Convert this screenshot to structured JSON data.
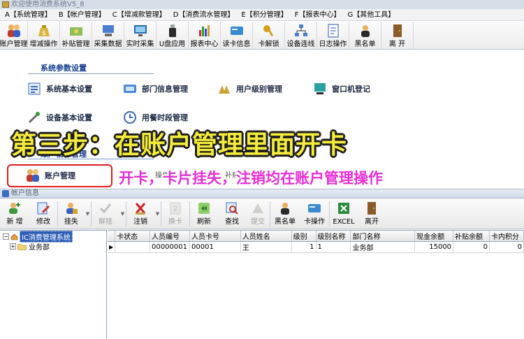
{
  "window": {
    "title": "欢迎使用消费系统V5_8"
  },
  "menu": [
    "A【系统管理】",
    "B【帐户管理】",
    "C【增减款管理】",
    "D【消费流水管理】",
    "E【积分管理】",
    "F【报表中心】",
    "G【其他工具】"
  ],
  "toolbar": [
    {
      "label": "账户管理",
      "icon": "users-icon"
    },
    {
      "label": "增减操作",
      "icon": "money-bag-icon"
    },
    {
      "label": "补贴管理",
      "icon": "subsidy-icon"
    },
    {
      "label": "采集数据",
      "icon": "collect-data-icon"
    },
    {
      "label": "实时采集",
      "icon": "realtime-monitor-icon"
    },
    {
      "label": "U盘应用",
      "icon": "usb-drive-icon"
    },
    {
      "label": "报表中心",
      "icon": "bar-chart-icon"
    },
    {
      "label": "读卡信息",
      "icon": "card-reader-icon"
    },
    {
      "label": "卡解锁",
      "icon": "key-icon"
    },
    {
      "label": "设备连线",
      "icon": "network-icon"
    },
    {
      "label": "日志操作",
      "icon": "log-icon"
    },
    {
      "label": "黑名单",
      "icon": "blacklist-icon"
    },
    {
      "label": "离 开",
      "icon": "exit-door-icon"
    }
  ],
  "panel": {
    "section1_title": "系统参数设置",
    "section2_title": "账户信息管理",
    "items": {
      "sys_basic": "系统基本设置",
      "dept_info": "部门信息管理",
      "user_level": "用户级别管理",
      "terminal_reg": "窗口机登记",
      "device_basic": "设备基本设置",
      "meal_period": "用餐时段管理",
      "account_mgmt": "账户管理",
      "hidden_item_a": "操作",
      "hidden_item_b": "补贴管"
    }
  },
  "captions": {
    "main": "第三步：在账户管理里面开卡",
    "sub": "开卡，卡片挂失，注销均在账户管理操作"
  },
  "child_window": {
    "title": "帐户信息",
    "toolbar": [
      {
        "label": "新 增",
        "enabled": true,
        "icon": "add-user-icon"
      },
      {
        "label": "修改",
        "enabled": true,
        "icon": "edit-icon"
      },
      {
        "label": "挂失",
        "enabled": true,
        "icon": "lock-icon"
      },
      {
        "label": "解挂",
        "enabled": false,
        "icon": "checkmark-icon"
      },
      {
        "label": "注销",
        "enabled": true,
        "icon": "cancel-x-icon"
      },
      {
        "label": "换卡",
        "enabled": false,
        "icon": "change-card-icon"
      },
      {
        "label": "刷新",
        "enabled": true,
        "icon": "refresh-icon"
      },
      {
        "label": "查找",
        "enabled": true,
        "icon": "search-icon"
      },
      {
        "label": "提交",
        "enabled": false,
        "icon": "submit-icon"
      },
      {
        "label": "黑名单",
        "enabled": true,
        "icon": "blacklist-icon"
      },
      {
        "label": "卡操作",
        "enabled": true,
        "icon": "card-operation-icon"
      },
      {
        "label": "EXCEL",
        "enabled": true,
        "icon": "excel-icon"
      },
      {
        "label": "离开",
        "enabled": true,
        "icon": "exit-door-icon"
      }
    ],
    "tree": {
      "root_expander": "−",
      "root": "IC消费管理系统",
      "child_expander": "+",
      "child": "业务部"
    },
    "grid": {
      "columns": [
        "卡状态",
        "人员编号",
        "人员卡号",
        "人员姓名",
        "级别",
        "级别名称",
        "部门名称",
        "现金余额",
        "补贴余额",
        "卡内积分"
      ],
      "indicator": "▶",
      "rows": [
        [
          "",
          "00000001",
          "00001",
          "王",
          "1",
          "1",
          "业务部",
          "15000",
          "0",
          "0"
        ]
      ]
    }
  }
}
